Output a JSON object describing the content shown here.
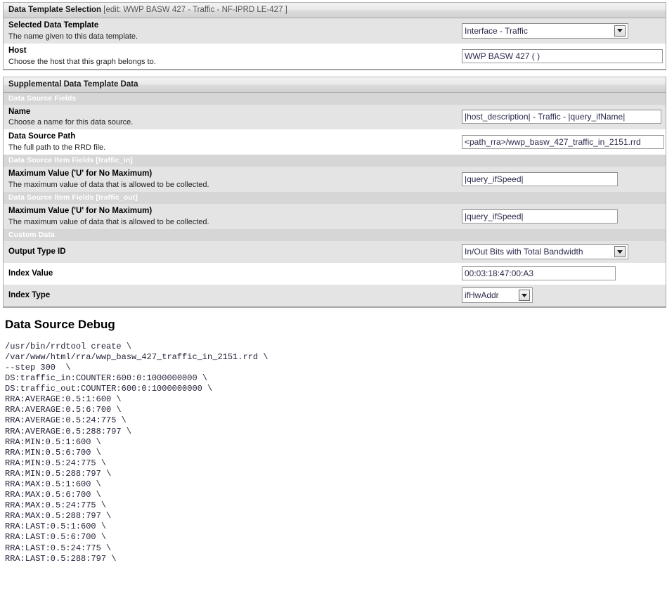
{
  "selection_panel": {
    "title_strong": "Data Template Selection",
    "title_edit": "[edit: WWP BASW 427 - Traffic - NF-IPRD LE-427 ]",
    "rows": [
      {
        "label": "Selected Data Template",
        "desc": "The name given to this data template.",
        "value": "Interface - Traffic",
        "control": "select"
      },
      {
        "label": "Host",
        "desc": "Choose the host that this graph belongs to.",
        "value": "WWP BASW 427 (                    )",
        "control": "text"
      }
    ]
  },
  "supplemental_panel": {
    "title_strong": "Supplemental Data Template Data",
    "subheaders": {
      "data_source_fields": "Data Source Fields",
      "item_fields_in": "Data Source Item Fields [traffic_in]",
      "item_fields_out": "Data Source Item Fields [traffic_out]",
      "custom_data": "Custom Data"
    },
    "name_row": {
      "label": "Name",
      "desc": "Choose a name for this data source.",
      "value": "|host_description| - Traffic - |query_ifName|"
    },
    "path_row": {
      "label": "Data Source Path",
      "desc": "The full path to the RRD file.",
      "value": "<path_rra>/wwp_basw_427_traffic_in_2151.rrd"
    },
    "max_in_row": {
      "label": "Maximum Value ('U' for No Maximum)",
      "desc": "The maximum value of data that is allowed to be collected.",
      "value": "|query_ifSpeed|"
    },
    "max_out_row": {
      "label": "Maximum Value ('U' for No Maximum)",
      "desc": "The maximum value of data that is allowed to be collected.",
      "value": "|query_ifSpeed|"
    },
    "output_type_row": {
      "label": "Output Type ID",
      "value": "In/Out Bits with Total Bandwidth"
    },
    "index_value_row": {
      "label": "Index Value",
      "value": "00:03:18:47:00:A3"
    },
    "index_type_row": {
      "label": "Index Type",
      "value": "ifHwAddr"
    }
  },
  "debug": {
    "title": "Data Source Debug",
    "lines": [
      "/usr/bin/rrdtool create \\",
      "/var/www/html/rra/wwp_basw_427_traffic_in_2151.rrd \\",
      "--step 300  \\",
      "DS:traffic_in:COUNTER:600:0:1000000000 \\",
      "DS:traffic_out:COUNTER:600:0:1000000000 \\",
      "RRA:AVERAGE:0.5:1:600 \\",
      "RRA:AVERAGE:0.5:6:700 \\",
      "RRA:AVERAGE:0.5:24:775 \\",
      "RRA:AVERAGE:0.5:288:797 \\",
      "RRA:MIN:0.5:1:600 \\",
      "RRA:MIN:0.5:6:700 \\",
      "RRA:MIN:0.5:24:775 \\",
      "RRA:MIN:0.5:288:797 \\",
      "RRA:MAX:0.5:1:600 \\",
      "RRA:MAX:0.5:6:700 \\",
      "RRA:MAX:0.5:24:775 \\",
      "RRA:MAX:0.5:288:797 \\",
      "RRA:LAST:0.5:1:600 \\",
      "RRA:LAST:0.5:6:700 \\",
      "RRA:LAST:0.5:24:775 \\",
      "RRA:LAST:0.5:288:797 \\"
    ]
  },
  "colors": {
    "row_alt": "#e4e4e4",
    "row_plain": "#ffffff",
    "subheader_bg": "#d6d6d6",
    "panel_border": "#aaaaaa",
    "input_text": "#2b2b4d"
  }
}
